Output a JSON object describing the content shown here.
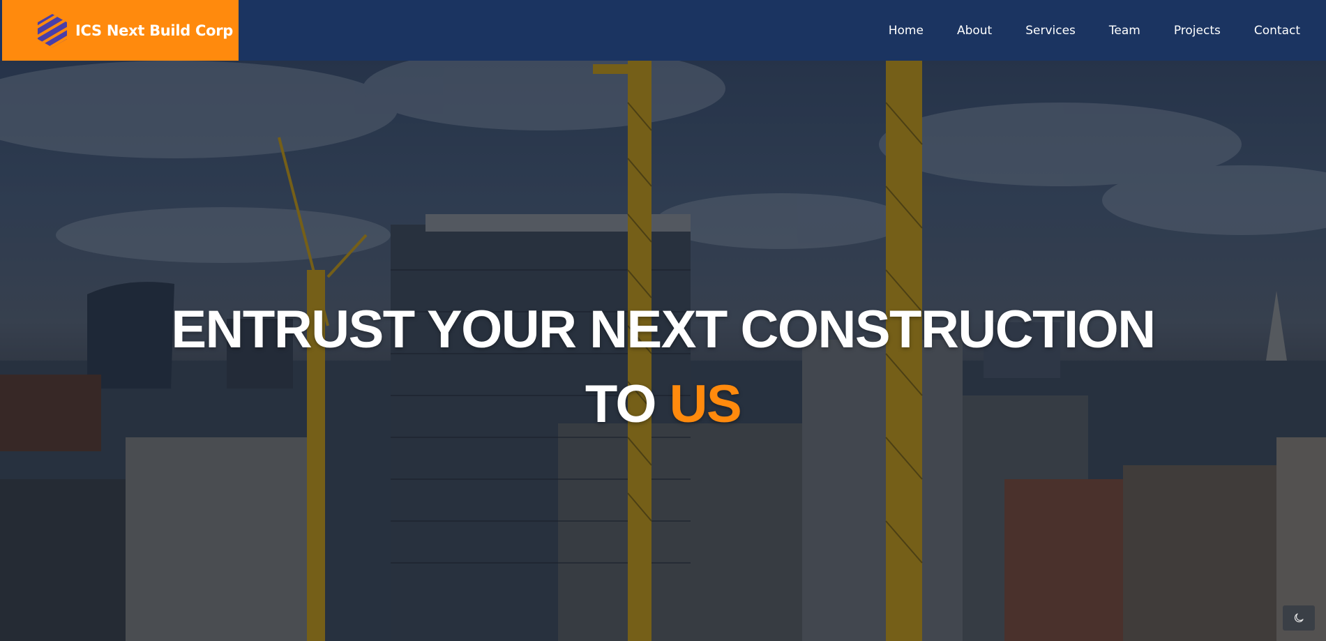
{
  "brand": {
    "name": "ICS Next Build Corp",
    "logo_icon": "hexagon-stripes-logo",
    "colors": {
      "brand_bg": "#ff8a0d",
      "logo": "#4a3fa8"
    }
  },
  "nav": {
    "background": "#1b3461",
    "items": [
      {
        "label": "Home"
      },
      {
        "label": "About"
      },
      {
        "label": "Services"
      },
      {
        "label": "Team"
      },
      {
        "label": "Projects"
      },
      {
        "label": "Contact"
      }
    ]
  },
  "hero": {
    "title_line1": "ENTRUST YOUR NEXT CONSTRUCTION",
    "title_line2_prefix": "TO",
    "title_line2_accent": "US",
    "accent_color": "#ff8a0d",
    "background_image": "city-skyline-with-construction-cranes"
  },
  "theme_toggle": {
    "icon": "moon-icon"
  }
}
